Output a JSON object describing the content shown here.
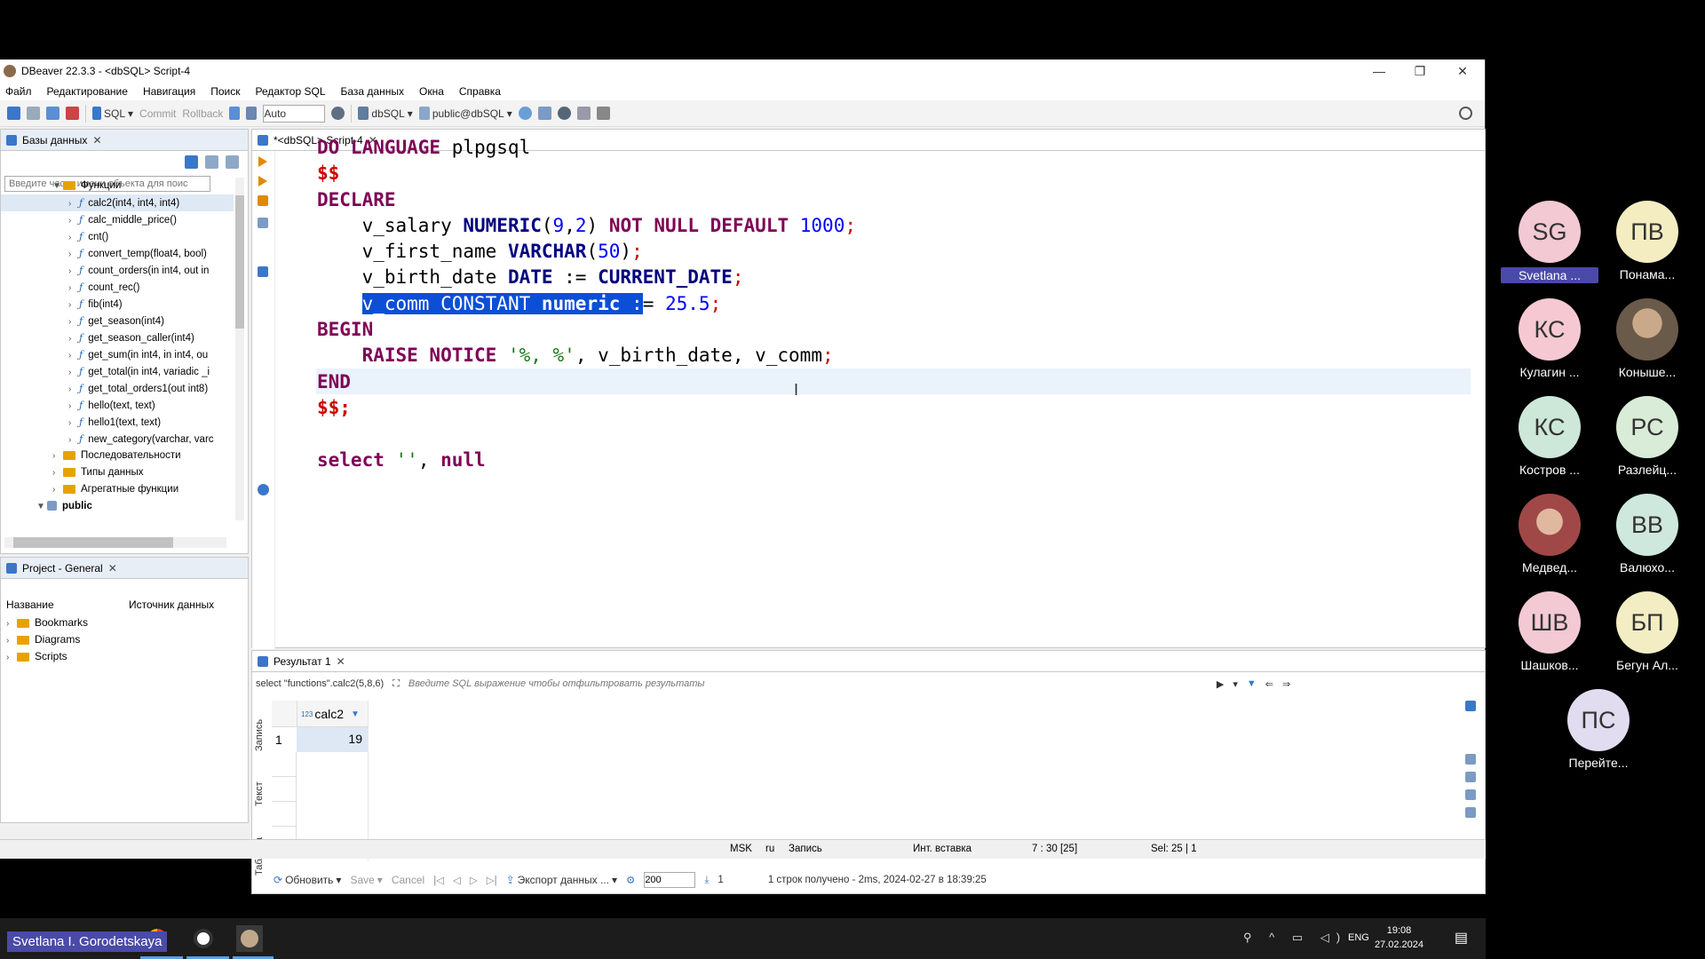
{
  "window": {
    "title": "DBeaver 22.3.3 - <dbSQL> Script-4"
  },
  "menu": [
    "Файл",
    "Редактирование",
    "Навигация",
    "Поиск",
    "Редактор SQL",
    "База данных",
    "Окна",
    "Справка"
  ],
  "toolbar": {
    "sql": "SQL",
    "commit": "Commit",
    "rollback": "Rollback",
    "auto": "Auto",
    "datasource": "dbSQL",
    "schema": "public@dbSQL"
  },
  "navigator": {
    "tab": "Базы данных",
    "filter_placeholder": "Введите часть имени объекта для поис",
    "folder_functions": "Функции",
    "functions": [
      "calc2(int4, int4, int4)",
      "calc_middle_price()",
      "cnt()",
      "convert_temp(float4, bool)",
      "count_orders(in int4, out in",
      "count_rec()",
      "fib(int4)",
      "get_season(int4)",
      "get_season_caller(int4)",
      "get_sum(in int4, in int4, ou",
      "get_total(in int4, variadic _i",
      "get_total_orders1(out int8)",
      "hello(text, text)",
      "hello1(text, text)",
      "new_category(varchar, varc"
    ],
    "folders": [
      "Последовательности",
      "Типы данных",
      "Агрегатные функции"
    ],
    "schema": "public"
  },
  "project": {
    "tab": "Project - General",
    "col_name": "Название",
    "col_source": "Источник данных",
    "items": [
      "Bookmarks",
      "Diagrams",
      "Scripts"
    ]
  },
  "editor": {
    "tab": "*<dbSQL> Script-4"
  },
  "results": {
    "tab": "Результат 1",
    "query": "select \"functions\".calc2(5,8,6)",
    "filter_placeholder": "Введите SQL выражение чтобы отфильтровать результаты",
    "column": "calc2",
    "column_type": "123",
    "row_num": "1",
    "value": "19",
    "side_tabs": [
      "Таблица",
      "Текст",
      "Запись"
    ],
    "refresh": "Обновить",
    "save": "Save",
    "cancel": "Cancel",
    "export": "Экспорт данных ...",
    "fetch_size": "200",
    "count": "1",
    "summary": "1 строк получено - 2ms, 2024-02-27 в 18:39:25"
  },
  "status": {
    "tz": "MSK",
    "lang": "ru",
    "mode": "Запись",
    "insert": "Инт. вставка",
    "pos": "7 : 30 [25]",
    "sel": "Sel: 25 | 1"
  },
  "taskbar": {
    "lang": "ENG",
    "time": "19:08",
    "date": "27.02.2024"
  },
  "participants": [
    {
      "initials": "SG",
      "name": "Svetlana ...",
      "color": "#f3c9d3"
    },
    {
      "initials": "ПВ",
      "name": "Понама...",
      "color": "#f4edc2"
    },
    {
      "initials": "КС",
      "name": "Кулагин ...",
      "color": "#f6c9d2"
    },
    {
      "initials": "",
      "name": "Коныше...",
      "color": "#8a7a6a"
    },
    {
      "initials": "КС",
      "name": "Костров ...",
      "color": "#cde7d8"
    },
    {
      "initials": "РС",
      "name": "Разлейц...",
      "color": "#d9ecd8"
    },
    {
      "initials": "",
      "name": "Медвед...",
      "color": "#b06060"
    },
    {
      "initials": "ВВ",
      "name": "Валюхо...",
      "color": "#cfe8dd"
    },
    {
      "initials": "ШВ",
      "name": "Шашков...",
      "color": "#f3c9d3"
    },
    {
      "initials": "БП",
      "name": "Бегун Ал...",
      "color": "#f3edc4"
    },
    {
      "initials": "ПС",
      "name": "Перейте...",
      "color": "#e1dcef"
    }
  ],
  "speaker": "Svetlana I. Gorodetskaya"
}
